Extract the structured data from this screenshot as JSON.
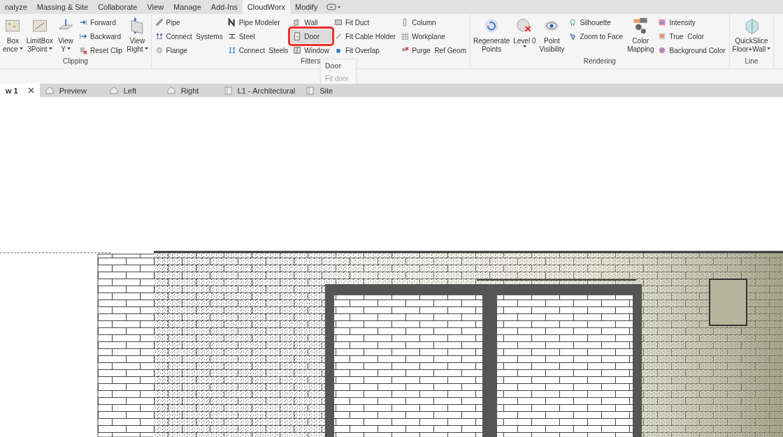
{
  "ribbon_tabs": [
    {
      "label": "nalyze",
      "selected": false
    },
    {
      "label": "Massing & Site",
      "selected": false
    },
    {
      "label": "Collaborate",
      "selected": false
    },
    {
      "label": "View",
      "selected": false
    },
    {
      "label": "Manage",
      "selected": false
    },
    {
      "label": "Add-Ins",
      "selected": false
    },
    {
      "label": "CloudWorx",
      "selected": true
    },
    {
      "label": "Modify",
      "selected": false
    }
  ],
  "ribbon": {
    "groups": [
      {
        "label": "Clipping",
        "columns": [
          {
            "kind": "large",
            "lines": [
              "Box",
              "ence"
            ],
            "dropdown": true
          },
          {
            "kind": "large",
            "lines": [
              "LimitBox",
              "3Point"
            ],
            "dropdown": true
          },
          {
            "kind": "large",
            "lines": [
              "View",
              "Y"
            ],
            "dropdown": true
          },
          {
            "kind": "stack",
            "items": [
              {
                "label": "Forward",
                "highlighted": false
              },
              {
                "label": "Backward",
                "highlighted": false
              },
              {
                "label": "Reset Clip",
                "highlighted": false
              }
            ]
          },
          {
            "kind": "large",
            "lines": [
              "View",
              "Right"
            ],
            "dropdown": true
          }
        ]
      },
      {
        "label": "Fitters",
        "columns": [
          {
            "kind": "stack",
            "items": [
              {
                "label": "Pipe",
                "highlighted": false
              },
              {
                "label": "Connect  Systems",
                "highlighted": false
              },
              {
                "label": "Flange",
                "highlighted": false
              }
            ]
          },
          {
            "kind": "stack",
            "items": [
              {
                "label": "Pipe Modeler",
                "highlighted": false
              },
              {
                "label": "Steel",
                "highlighted": false
              },
              {
                "label": "Connect  Steels",
                "highlighted": false
              }
            ]
          },
          {
            "kind": "stack",
            "items": [
              {
                "label": "Wall",
                "highlighted": false
              },
              {
                "label": "Door",
                "highlighted": true
              },
              {
                "label": "Window",
                "highlighted": false
              }
            ]
          },
          {
            "kind": "stack",
            "items": [
              {
                "label": "Fit Duct",
                "highlighted": false
              },
              {
                "label": "Fit Cable Holder",
                "highlighted": false
              },
              {
                "label": "Fit Overlap",
                "highlighted": false
              }
            ]
          },
          {
            "kind": "stack",
            "items": [
              {
                "label": "Column",
                "highlighted": false
              },
              {
                "label": "Workplane",
                "highlighted": false
              },
              {
                "label": "Purge  Ref Geom",
                "highlighted": false
              }
            ]
          }
        ]
      },
      {
        "label": "Rendering",
        "columns": [
          {
            "kind": "large",
            "lines": [
              "Regenerate",
              "Points"
            ],
            "dropdown": false
          },
          {
            "kind": "large",
            "lines": [
              "Level 0"
            ],
            "dropdown": true
          },
          {
            "kind": "large",
            "lines": [
              "Point",
              "Visibility"
            ],
            "dropdown": false
          },
          {
            "kind": "stack",
            "items": [
              {
                "label": "Silhouette",
                "highlighted": false
              },
              {
                "label": "Zoom to Face",
                "highlighted": false
              }
            ]
          },
          {
            "kind": "large",
            "lines": [
              "Color",
              "Mapping"
            ],
            "dropdown": false
          },
          {
            "kind": "stack",
            "items": [
              {
                "label": "Intensity",
                "highlighted": false
              },
              {
                "label": "True  Color",
                "highlighted": false
              },
              {
                "label": "Background Color",
                "highlighted": false
              }
            ]
          }
        ]
      },
      {
        "label": "Line",
        "columns": [
          {
            "kind": "large",
            "lines": [
              "QuickSlice",
              "Floor+Wall"
            ],
            "dropdown": true
          }
        ]
      }
    ]
  },
  "tooltip": {
    "title": "Door",
    "description": "Fit door"
  },
  "view_tabs": [
    {
      "label": "w 1",
      "selected": true,
      "closable": true
    },
    {
      "label": "Preview",
      "selected": false,
      "closable": false
    },
    {
      "label": "Left",
      "selected": false,
      "closable": false
    },
    {
      "label": "Right",
      "selected": false,
      "closable": false
    },
    {
      "label": "L1 - Architectural",
      "selected": false,
      "closable": false
    },
    {
      "label": "Site",
      "selected": false,
      "closable": false
    }
  ]
}
